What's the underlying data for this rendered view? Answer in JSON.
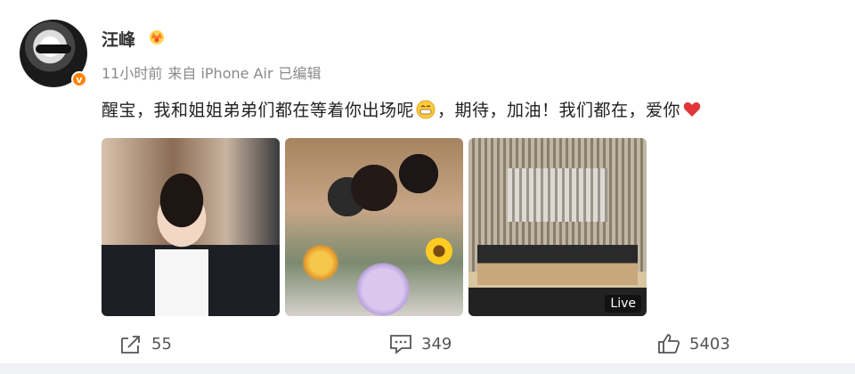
{
  "post": {
    "author": "汪峰",
    "time": "11小时前",
    "source": "来自 iPhone Air",
    "edited": "已编辑",
    "text_main": "醒宝，我和姐姐弟弟们都在等着你出场呢",
    "text_after_emoji": "，期待，加油！我们都在，爱你",
    "badge": "v",
    "emoji_grin_icon": "grinning-face-emoji",
    "emoji_heart_icon": "red-heart-emoji"
  },
  "photos": [
    {
      "name": "photo-girl-violin"
    },
    {
      "name": "photo-family-flowers"
    },
    {
      "name": "photo-concert-hall",
      "live_label": "Live"
    }
  ],
  "actions": {
    "share": {
      "icon": "share-icon",
      "count": "55"
    },
    "comment": {
      "icon": "comment-icon",
      "count": "349"
    },
    "like": {
      "icon": "thumbs-up-icon",
      "count": "5403"
    }
  },
  "colors": {
    "background": "#f1f2f5",
    "card": "#ffffff",
    "vip_badge": "#ff8200",
    "meta_text": "#8a8a8a",
    "heart": "#e0363a"
  }
}
